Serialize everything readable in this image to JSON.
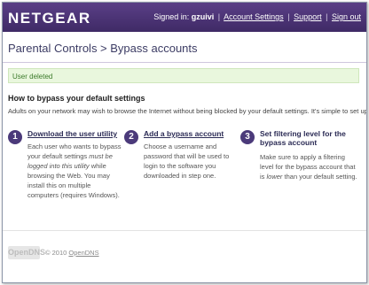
{
  "header": {
    "brand": "NETGEAR",
    "signed_in_prefix": "Signed in:",
    "username": "gzuivi",
    "sep": "|",
    "links": {
      "account_settings": "Account Settings",
      "support": "Support",
      "sign_out": "Sign out"
    }
  },
  "page": {
    "breadcrumb": "Parental Controls > Bypass accounts"
  },
  "alert": {
    "message": "User deleted"
  },
  "section": {
    "title": "How to bypass your default settings",
    "intro": "Adults on your network may wish to browse the Internet without being blocked by your default settings. It's simple to set up."
  },
  "steps": [
    {
      "number": "1",
      "title": "Download the user utility",
      "body_a": "Each user who wants to bypass your default settings ",
      "body_i": "must be logged into this utility",
      "body_b": " while browsing the Web. You may install this on multiple computers (requires Windows)."
    },
    {
      "number": "2",
      "title": "Add a bypass account",
      "body": "Choose a username and password that will be used to login to the software you downloaded in step one."
    },
    {
      "number": "3",
      "title": "Set filtering level for the bypass account",
      "body_a": "Make sure to apply a filtering level for the bypass account that is ",
      "body_i": "lower",
      "body_b": " than your default setting."
    }
  ],
  "footer": {
    "logo": "OpenDNS",
    "copyright": "© 2010",
    "link": "OpenDNS"
  }
}
